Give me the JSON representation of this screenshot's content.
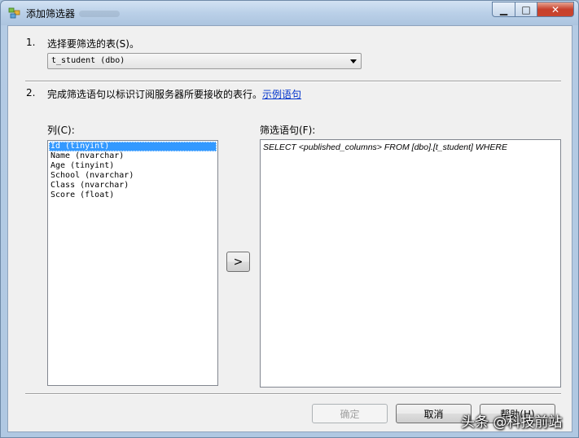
{
  "window": {
    "title": "添加筛选器",
    "minimize_label": "▁",
    "maximize_label": "□",
    "close_label": "✕"
  },
  "step1": {
    "number": "1.",
    "label": "选择要筛选的表(S)。",
    "table_value": "t_student (dbo)"
  },
  "step2": {
    "number": "2.",
    "label": "完成筛选语句以标识订阅服务器所要接收的表行。",
    "example_link": "示例语句"
  },
  "columns": {
    "label": "列(C):",
    "items": [
      "Id (tinyint)",
      "Name (nvarchar)",
      "Age (tinyint)",
      "School (nvarchar)",
      "Class (nvarchar)",
      "Score (float)"
    ],
    "selected_index": 0
  },
  "move_button": {
    "label": ">"
  },
  "filter": {
    "label": "筛选语句(F):",
    "statement": "SELECT <published_columns> FROM [dbo].[t_student] WHERE"
  },
  "buttons": {
    "ok": "确定",
    "cancel": "取消",
    "help": "帮助(H)"
  },
  "watermark": "头条 @科技前站",
  "colors": {
    "selection": "#3399ff",
    "link": "#0033cc",
    "close_button": "#c7412c"
  }
}
